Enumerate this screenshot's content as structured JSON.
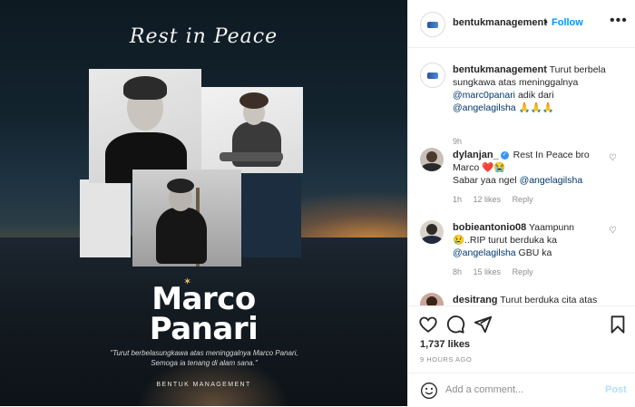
{
  "image": {
    "script_title": "Rest in Peace",
    "name_line1": "Marco",
    "name_line2": "Panari",
    "quote": "\"Turut berbelasungkawa atas meninggalnya Marco Panari, Semoga ia tenang di alam sana.\"",
    "org": "BENTUK MANAGEMENT"
  },
  "header": {
    "username": "bentukmanagement",
    "separator": "•",
    "follow_label": "Follow",
    "more_icon": "more-dots-icon"
  },
  "caption": {
    "username": "bentukmanagement",
    "text1": "Turut berbela sungkawa atas meninggalnya",
    "mention1": "@marc0panari",
    "text2": "adik dari",
    "mention2": "@angelagilsha",
    "emoji": "🙏🙏🙏",
    "time": "9h"
  },
  "comments": [
    {
      "username": "dylanjan_",
      "text": "Rest In Peace bro Marco",
      "emoji": "❤️😭",
      "line2": "Sabar yaa ngel",
      "mention": "@angelagilsha",
      "time": "1h",
      "likes": "12 likes",
      "reply": "Reply"
    },
    {
      "username": "bobieantonio08",
      "text": "Yaampunn",
      "emoji": "😢",
      "line2": "..RIP turut berduka ka",
      "mention": "@angelagilsha",
      "line3": "GBU ka",
      "time": "8h",
      "likes": "15 likes",
      "reply": "Reply"
    },
    {
      "username": "desitrang",
      "text": "Turut berduka cita atas"
    }
  ],
  "actions": {
    "likes": "1,737 likes",
    "timestamp": "9 HOURS AGO",
    "comment_placeholder": "Add a comment...",
    "post_label": "Post"
  },
  "colors": {
    "follow_blue": "#0095f6",
    "mention_blue": "#00376b",
    "post_disabled": "#b2dffc"
  }
}
